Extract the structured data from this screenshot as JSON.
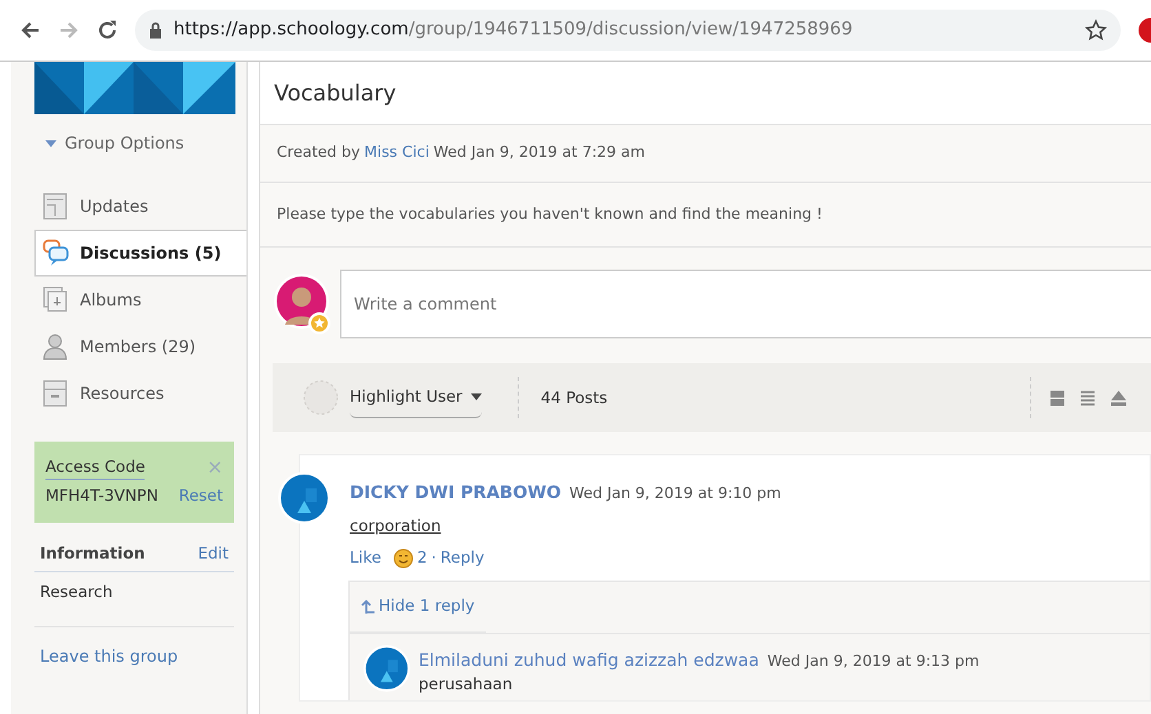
{
  "browser": {
    "url_host": "https://app.schoology.com",
    "url_path": "/group/1946711509/discussion/view/1947258969",
    "forward_disabled": true
  },
  "sidebar": {
    "group_options": "Group Options",
    "nav": [
      {
        "label": "Updates",
        "kind": "updates",
        "selected": false
      },
      {
        "label": "Discussions (5)",
        "kind": "discussions",
        "selected": true
      },
      {
        "label": "Albums",
        "kind": "albums",
        "selected": false
      },
      {
        "label": "Members (29)",
        "kind": "members",
        "selected": false
      },
      {
        "label": "Resources",
        "kind": "resources",
        "selected": false
      }
    ],
    "access_code": {
      "title": "Access Code",
      "close": "×",
      "code": "MFH4T-3VNPN",
      "reset": "Reset"
    },
    "information": {
      "title": "Information",
      "edit": "Edit",
      "text": "Research"
    },
    "leave": "Leave this group"
  },
  "discussion": {
    "title": "Vocabulary",
    "created_prefix": "Created by",
    "author": "Miss Cici",
    "created_time": "Wed Jan 9, 2019 at 7:29 am",
    "description": "Please type the vocabularies you haven't known and find the meaning !",
    "comment_placeholder": "Write a comment",
    "toolbar": {
      "highlight": "Highlight User",
      "posts": "44 Posts"
    },
    "comments": [
      {
        "author": "DICKY DWI PRABOWO",
        "time": "Wed Jan 9, 2019 at 9:10 pm",
        "body": "corporation",
        "like": "Like",
        "likes": "2",
        "separator": "·",
        "reply": "Reply",
        "toggle": "Hide 1 reply",
        "replies": [
          {
            "author": "Elmiladuni zuhud wafig azizzah edzwaa",
            "time": "Wed Jan 9, 2019 at 9:13 pm",
            "body": "perusahaan"
          }
        ]
      }
    ]
  }
}
